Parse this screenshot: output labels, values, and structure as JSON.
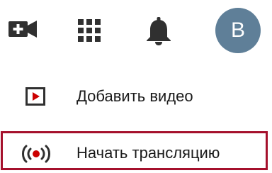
{
  "header": {
    "create_icon": "video-camera-plus-icon",
    "apps_icon": "apps-grid-icon",
    "notifications_icon": "bell-icon",
    "avatar_letter": "B",
    "avatar_color": "#5f7f98"
  },
  "menu": {
    "items": [
      {
        "label": "Добавить видео",
        "icon": "upload-video-icon"
      },
      {
        "label": "Начать трансляцию",
        "icon": "live-broadcast-icon"
      }
    ]
  },
  "colors": {
    "highlight_border": "#a5102c",
    "live_red": "#cc0000",
    "icon_dark": "#303030"
  }
}
